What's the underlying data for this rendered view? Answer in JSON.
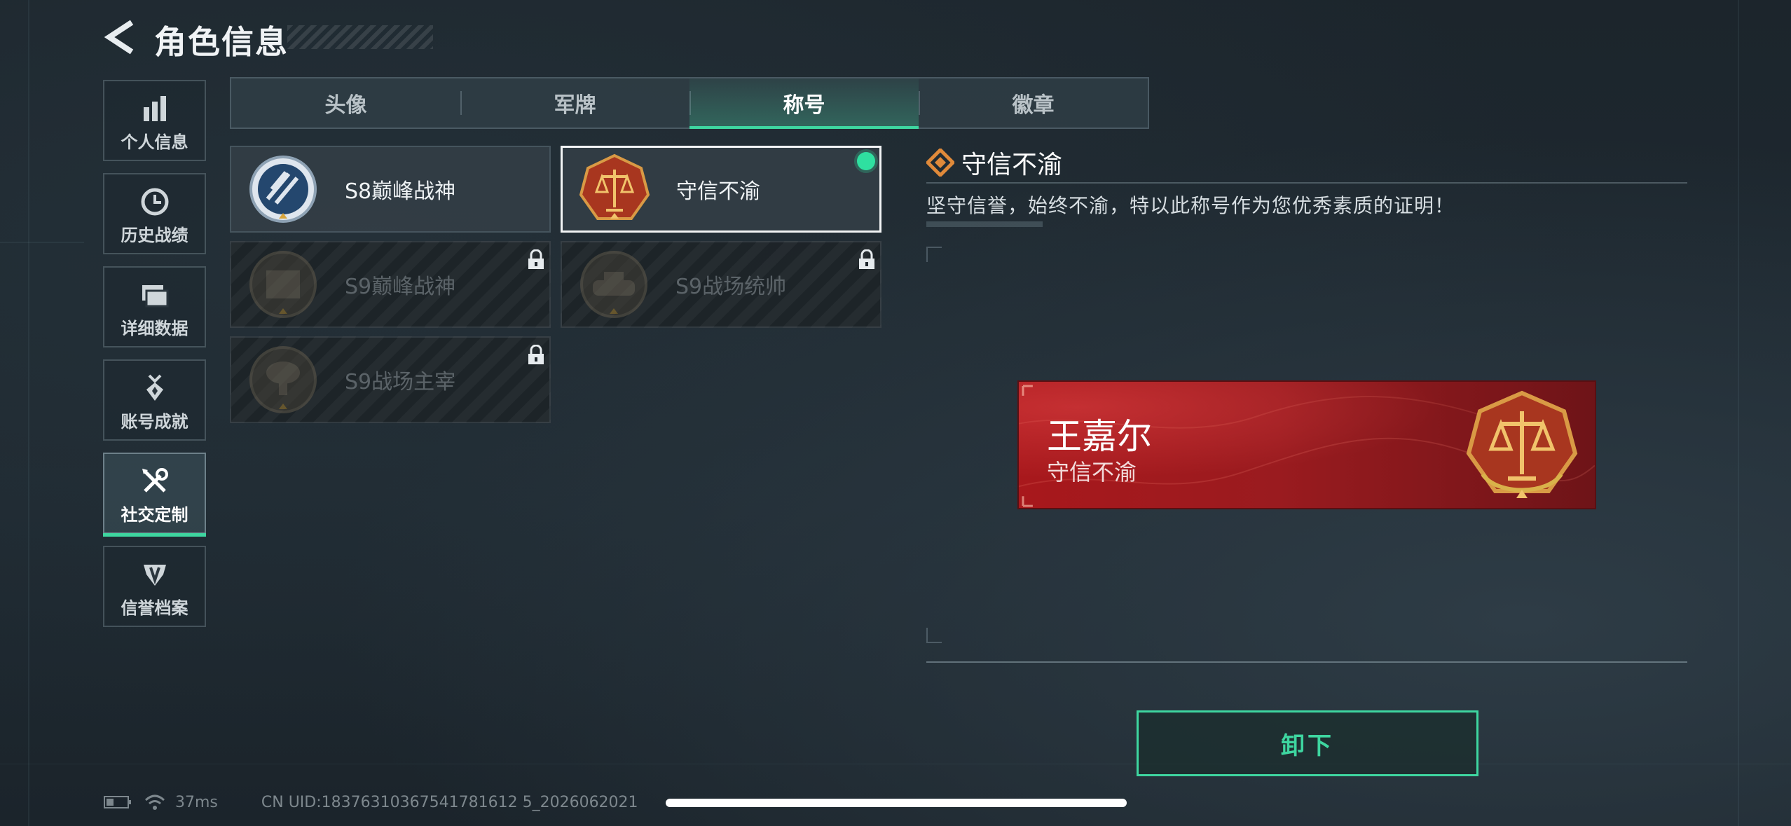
{
  "header": {
    "title": "角色信息"
  },
  "sidebar": {
    "items": [
      {
        "label": "个人信息",
        "icon": "bar-chart-icon",
        "active": false
      },
      {
        "label": "历史战绩",
        "icon": "clock-icon",
        "active": false
      },
      {
        "label": "详细数据",
        "icon": "folder-icon",
        "active": false
      },
      {
        "label": "账号成就",
        "icon": "medal-icon",
        "active": false
      },
      {
        "label": "社交定制",
        "icon": "tools-icon",
        "active": true
      },
      {
        "label": "信誉档案",
        "icon": "shield-icon",
        "active": false
      }
    ]
  },
  "tabs": [
    {
      "label": "头像",
      "active": false
    },
    {
      "label": "军牌",
      "active": false
    },
    {
      "label": "称号",
      "active": true
    },
    {
      "label": "徽章",
      "active": false
    }
  ],
  "titles": [
    {
      "name": "S8巅峰战神",
      "locked": false,
      "selected": false,
      "badge": "peak-badge-icon"
    },
    {
      "name": "守信不渝",
      "locked": false,
      "selected": true,
      "equipped": true,
      "badge": "scales-badge-icon"
    },
    {
      "name": "S9巅峰战神",
      "locked": true,
      "badge": "building-badge-icon"
    },
    {
      "name": "S9战场统帅",
      "locked": true,
      "badge": "tank-badge-icon"
    },
    {
      "name": "S9战场主宰",
      "locked": true,
      "badge": "explosion-badge-icon"
    }
  ],
  "detail": {
    "title": "守信不渝",
    "description": "坚守信誉，始终不渝，特以此称号作为您优秀素质的证明！"
  },
  "nameplate": {
    "player_name": "王嘉尔",
    "title": "守信不渝",
    "color": "#a8181c"
  },
  "actions": {
    "unequip_label": "卸下"
  },
  "status": {
    "latency": "37ms",
    "uid": "CN UID:18376310367541781612 5_2026062021"
  },
  "colors": {
    "accent": "#3ed6a0"
  }
}
